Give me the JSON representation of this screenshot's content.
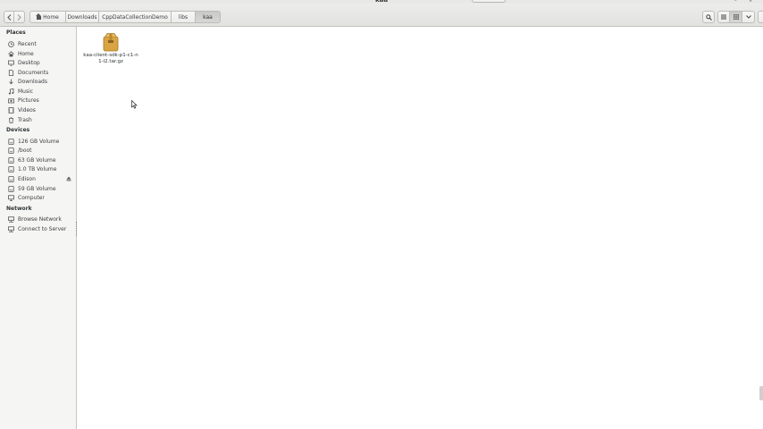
{
  "window": {
    "title": "kaa"
  },
  "pathbar": {
    "crumbs": [
      {
        "label": "Home"
      },
      {
        "label": "Downloads"
      },
      {
        "label": "CppDataCollectionDemo"
      },
      {
        "label": "libs"
      },
      {
        "label": "kaa"
      }
    ]
  },
  "sidebar": {
    "places_heading": "Places",
    "places": [
      {
        "label": "Recent",
        "icon": "clock-icon"
      },
      {
        "label": "Home",
        "icon": "home-icon"
      },
      {
        "label": "Desktop",
        "icon": "desktop-icon"
      },
      {
        "label": "Documents",
        "icon": "document-icon"
      },
      {
        "label": "Downloads",
        "icon": "download-icon"
      },
      {
        "label": "Music",
        "icon": "music-icon"
      },
      {
        "label": "Pictures",
        "icon": "camera-icon"
      },
      {
        "label": "Videos",
        "icon": "film-icon"
      },
      {
        "label": "Trash",
        "icon": "trash-icon"
      }
    ],
    "devices_heading": "Devices",
    "devices": [
      {
        "label": "126 GB Volume",
        "icon": "drive-icon"
      },
      {
        "label": "/boot",
        "icon": "drive-icon"
      },
      {
        "label": "63 GB Volume",
        "icon": "drive-icon"
      },
      {
        "label": "1.0 TB Volume",
        "icon": "drive-icon"
      },
      {
        "label": "Edison",
        "icon": "drive-icon"
      },
      {
        "label": "59 GB Volume",
        "icon": "drive-icon"
      },
      {
        "label": "Computer",
        "icon": "computer-icon"
      }
    ],
    "network_heading": "Network",
    "network": [
      {
        "label": "Browse Network",
        "icon": "network-icon"
      },
      {
        "label": "Connect to Server",
        "icon": "server-icon"
      }
    ]
  },
  "files": [
    {
      "name": "kaa-client-sdk-p1-c1-n1-l2.tar.gz",
      "icon": "archive-icon"
    }
  ],
  "colors": {
    "archive": "#d9a441",
    "sidebar_bg": "#f5f5f4",
    "header_bg": "#e4e4e1"
  }
}
